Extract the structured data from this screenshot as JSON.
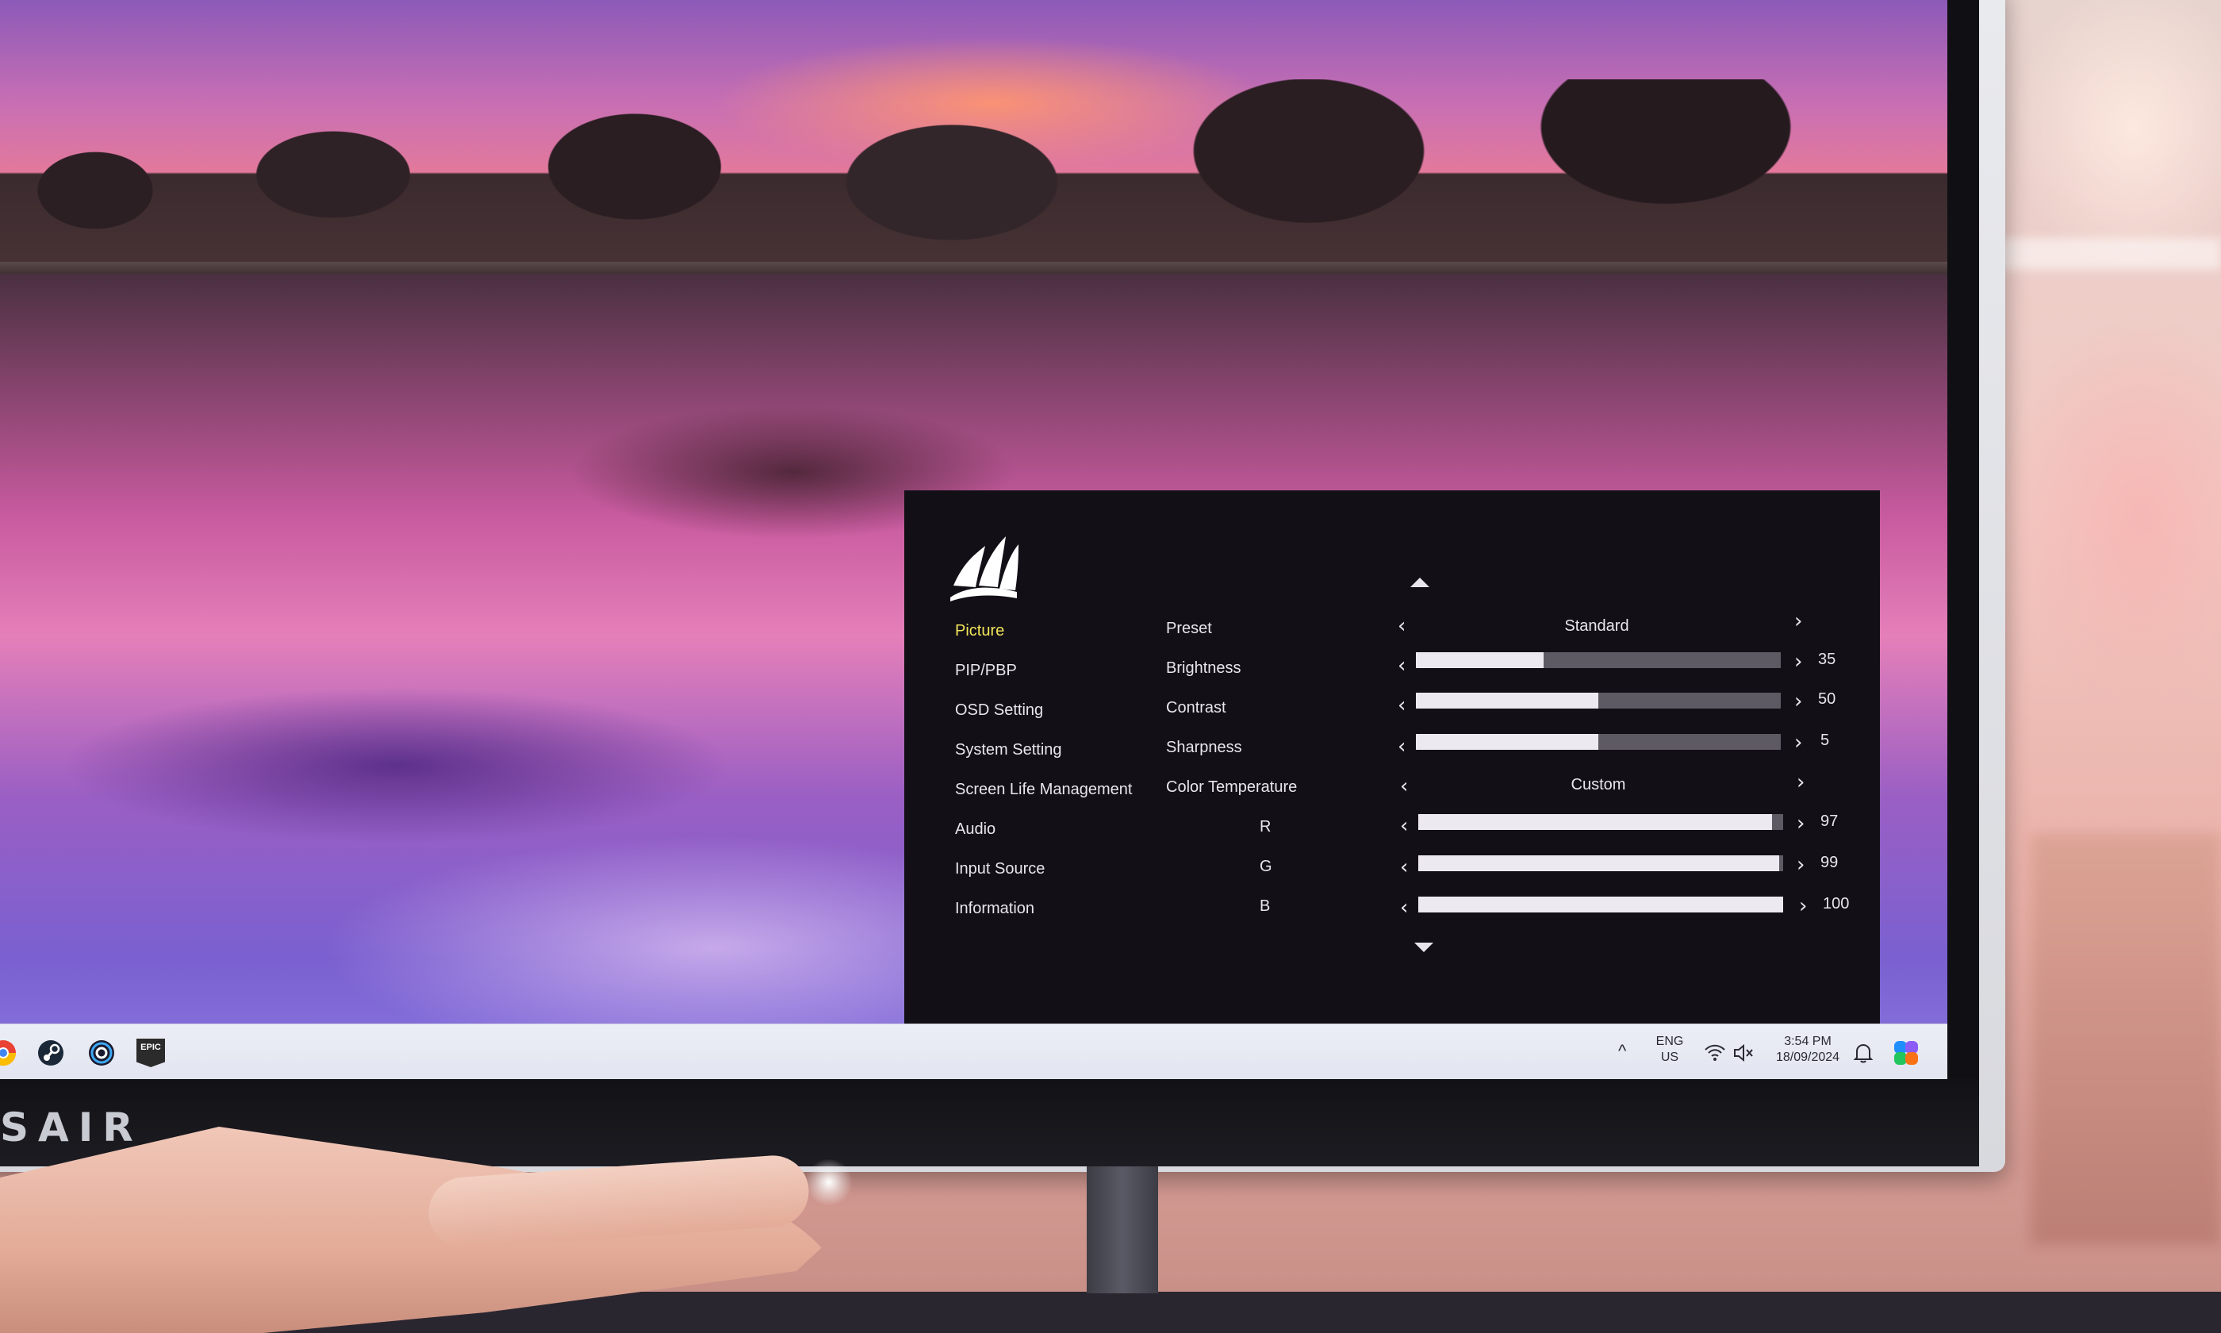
{
  "monitor": {
    "brand_text": "SAIR"
  },
  "osd": {
    "logo": "corsair-sails-icon",
    "menu": [
      {
        "label": "Picture",
        "active": true
      },
      {
        "label": "PIP/PBP",
        "active": false
      },
      {
        "label": "OSD Setting",
        "active": false
      },
      {
        "label": "System Setting",
        "active": false
      },
      {
        "label": "Screen Life Management",
        "active": false
      },
      {
        "label": "Audio",
        "active": false
      },
      {
        "label": "Input Source",
        "active": false
      },
      {
        "label": "Information",
        "active": false
      }
    ],
    "settings": {
      "preset": {
        "label": "Preset",
        "value": "Standard"
      },
      "brightness": {
        "label": "Brightness",
        "value": 35,
        "display": "35"
      },
      "contrast": {
        "label": "Contrast",
        "value": 50,
        "display": "50"
      },
      "sharpness": {
        "label": "Sharpness",
        "value": 5,
        "max": 10,
        "display": "5"
      },
      "color_temperature": {
        "label": "Color Temperature",
        "value": "Custom"
      },
      "r": {
        "label": "R",
        "value": 97,
        "display": "97"
      },
      "g": {
        "label": "G",
        "value": 99,
        "display": "99"
      },
      "b": {
        "label": "B",
        "value": 100,
        "display": "100"
      }
    },
    "colors": {
      "active_menu": "#f0e55a",
      "background": "#130f17",
      "slider_fill": "#eceaf0",
      "slider_track": "#5d5a63"
    }
  },
  "taskbar": {
    "left_icons": [
      "chrome-icon",
      "steam-icon",
      "ubisoft-icon",
      "epic-games-icon"
    ],
    "epic_label": "EPIC",
    "tray": {
      "language": "ENG",
      "region": "US",
      "time": "3:54 PM",
      "date": "18/09/2024"
    }
  }
}
